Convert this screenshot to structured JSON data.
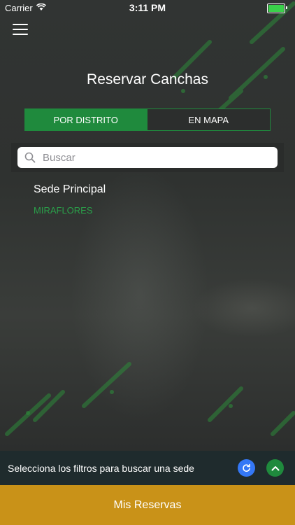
{
  "status_bar": {
    "carrier": "Carrier",
    "time": "3:11 PM"
  },
  "header": {
    "title": "Reservar Canchas",
    "menu_icon": "hamburger-menu-icon"
  },
  "tabs": [
    {
      "label": "POR DISTRITO",
      "active": true
    },
    {
      "label": "EN MAPA",
      "active": false
    }
  ],
  "search": {
    "placeholder": "Buscar",
    "value": ""
  },
  "venues": [
    {
      "name": "Sede Principal",
      "district": "MIRAFLORES"
    }
  ],
  "filter_bar": {
    "message": "Selecciona los filtros para buscar una sede"
  },
  "bottom_button": {
    "label": "Mis Reservas"
  },
  "colors": {
    "green": "#1f8a3d",
    "gold": "#c99218",
    "blue": "#3478f6"
  }
}
